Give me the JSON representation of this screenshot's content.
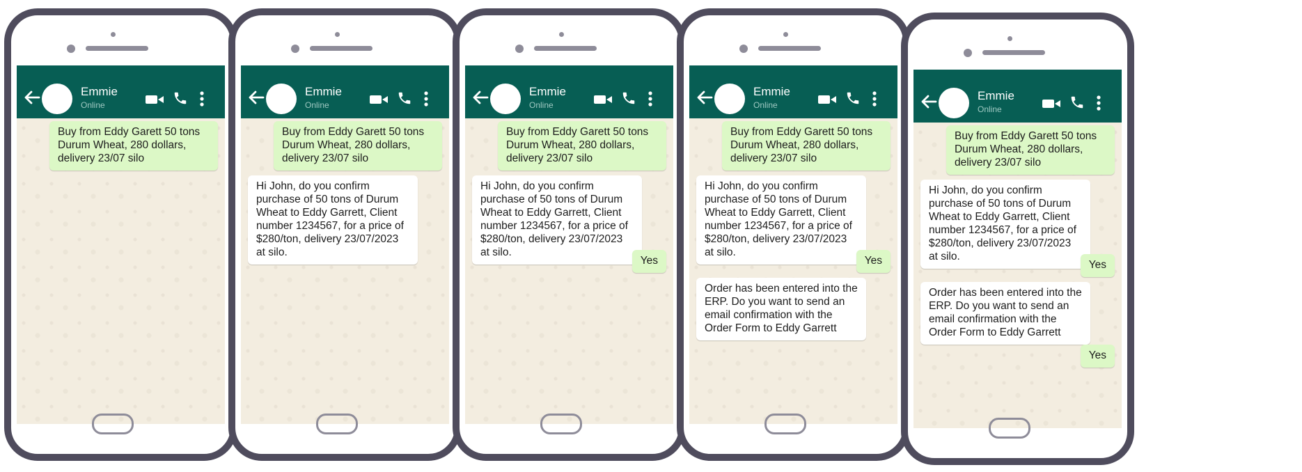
{
  "contact": {
    "name": "Emmie",
    "status": "Online"
  },
  "icons": [
    "arrow-left-icon",
    "video-camera-icon",
    "phone-handset-icon",
    "more-vertical-icon"
  ],
  "colors": {
    "header": "#075e54",
    "outgoing_bubble": "#dcf8c6",
    "incoming_bubble": "#ffffff",
    "chat_background": "#f3ede0",
    "phone_frame": "#4f4c5d"
  },
  "messages": {
    "request": "Buy from Eddy Garett 50 tons Durum Wheat, 280 dollars, delivery 23/07 silo",
    "confirm": "Hi John, do you confirm purchase of 50 tons of Durum Wheat to Eddy Garrett, Client number 1234567, for a price of $280/ton, delivery 23/07/2023 at silo.",
    "yes": "Yes",
    "order": "Order has been entered into the ERP. Do you want to send an email confirmation with the Order Form to Eddy Garrett"
  }
}
